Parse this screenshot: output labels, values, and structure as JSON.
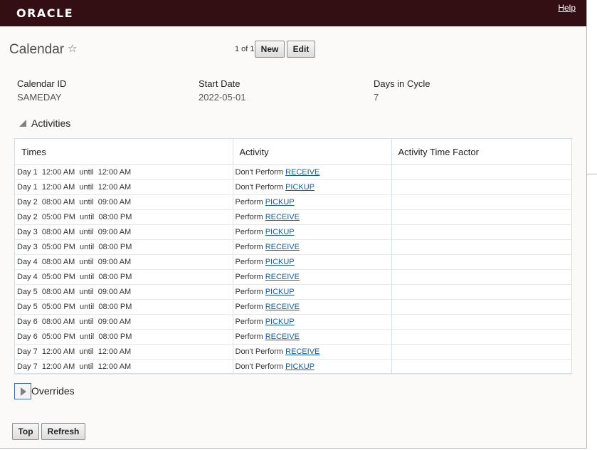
{
  "header": {
    "logo": "ORACLE",
    "help": "Help"
  },
  "page": {
    "title": "Calendar",
    "pager": "1 of 1"
  },
  "toolbar": {
    "new_label": "New",
    "edit_label": "Edit"
  },
  "fields": [
    {
      "label": "Calendar ID",
      "value": "SAMEDAY"
    },
    {
      "label": "Start Date",
      "value": "2022-05-01"
    },
    {
      "label": "Days in Cycle",
      "value": "7"
    }
  ],
  "activities": {
    "title": "Activities",
    "columns": [
      "Times",
      "Activity",
      "Activity Time Factor"
    ],
    "rows": [
      {
        "times": "Day 1  12:00 AM  until  12:00 AM",
        "prefix": "Don't Perform ",
        "link": "RECEIVE",
        "factor": ""
      },
      {
        "times": "Day 1  12:00 AM  until  12:00 AM",
        "prefix": "Don't Perform ",
        "link": "PICKUP",
        "factor": ""
      },
      {
        "times": "Day 2  08:00 AM  until  09:00 AM",
        "prefix": "Perform ",
        "link": "PICKUP",
        "factor": ""
      },
      {
        "times": "Day 2  05:00 PM  until  08:00 PM",
        "prefix": "Perform ",
        "link": "RECEIVE",
        "factor": ""
      },
      {
        "times": "Day 3  08:00 AM  until  09:00 AM",
        "prefix": "Perform ",
        "link": "PICKUP",
        "factor": ""
      },
      {
        "times": "Day 3  05:00 PM  until  08:00 PM",
        "prefix": "Perform ",
        "link": "RECEIVE",
        "factor": ""
      },
      {
        "times": "Day 4  08:00 AM  until  09:00 AM",
        "prefix": "Perform ",
        "link": "PICKUP",
        "factor": ""
      },
      {
        "times": "Day 4  05:00 PM  until  08:00 PM",
        "prefix": "Perform ",
        "link": "RECEIVE",
        "factor": ""
      },
      {
        "times": "Day 5  08:00 AM  until  09:00 AM",
        "prefix": "Perform ",
        "link": "PICKUP",
        "factor": ""
      },
      {
        "times": "Day 5  05:00 PM  until  08:00 PM",
        "prefix": "Perform ",
        "link": "RECEIVE",
        "factor": ""
      },
      {
        "times": "Day 6  08:00 AM  until  09:00 AM",
        "prefix": "Perform ",
        "link": "PICKUP",
        "factor": ""
      },
      {
        "times": "Day 6  05:00 PM  until  08:00 PM",
        "prefix": "Perform ",
        "link": "RECEIVE",
        "factor": ""
      },
      {
        "times": "Day 7  12:00 AM  until  12:00 AM",
        "prefix": "Don't Perform ",
        "link": "RECEIVE",
        "factor": ""
      },
      {
        "times": "Day 7  12:00 AM  until  12:00 AM",
        "prefix": "Don't Perform ",
        "link": "PICKUP",
        "factor": ""
      }
    ]
  },
  "overrides": {
    "title": "Overrides"
  },
  "footer": {
    "top_label": "Top",
    "refresh_label": "Refresh"
  },
  "icons": {
    "favorite": "star-outline-icon",
    "activities_toggle": "triangle-down-icon",
    "overrides_toggle": "triangle-right-icon"
  },
  "colors": {
    "header_bg": "#330e12",
    "link": "#145c9e",
    "page_bg": "#fbfaf9"
  }
}
